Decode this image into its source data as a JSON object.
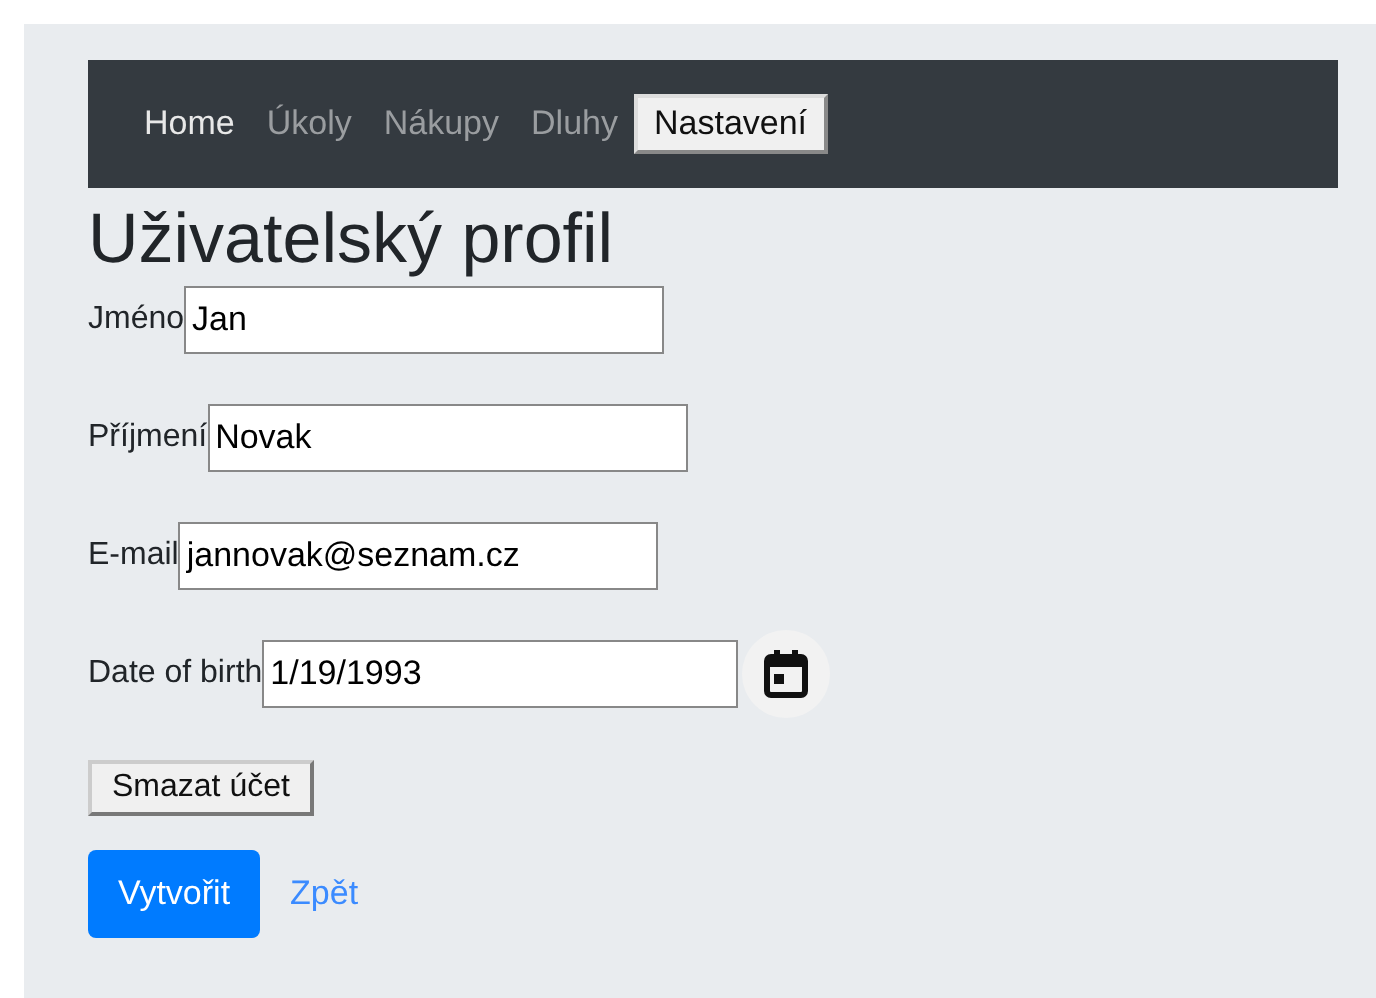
{
  "nav": {
    "items": [
      {
        "label": "Home",
        "kind": "brand",
        "selected": false
      },
      {
        "label": "Úkoly",
        "kind": "link",
        "selected": false
      },
      {
        "label": "Nákupy",
        "kind": "link",
        "selected": false
      },
      {
        "label": "Dluhy",
        "kind": "link",
        "selected": false
      },
      {
        "label": "Nastavení",
        "kind": "link",
        "selected": true
      }
    ]
  },
  "heading": "Uživatelský profil",
  "fields": [
    {
      "label": "Jméno",
      "value": "Jan",
      "kind": "text"
    },
    {
      "label": "Příjmení",
      "value": "Novak",
      "kind": "text"
    },
    {
      "label": "E-mail",
      "value": "jannovak@seznam.cz",
      "kind": "text"
    },
    {
      "label": "Date of birth",
      "value": "1/19/1993",
      "kind": "date"
    }
  ],
  "delete_button": "Smazat účet",
  "submit_button": "Vytvořit",
  "back_link": "Zpět"
}
